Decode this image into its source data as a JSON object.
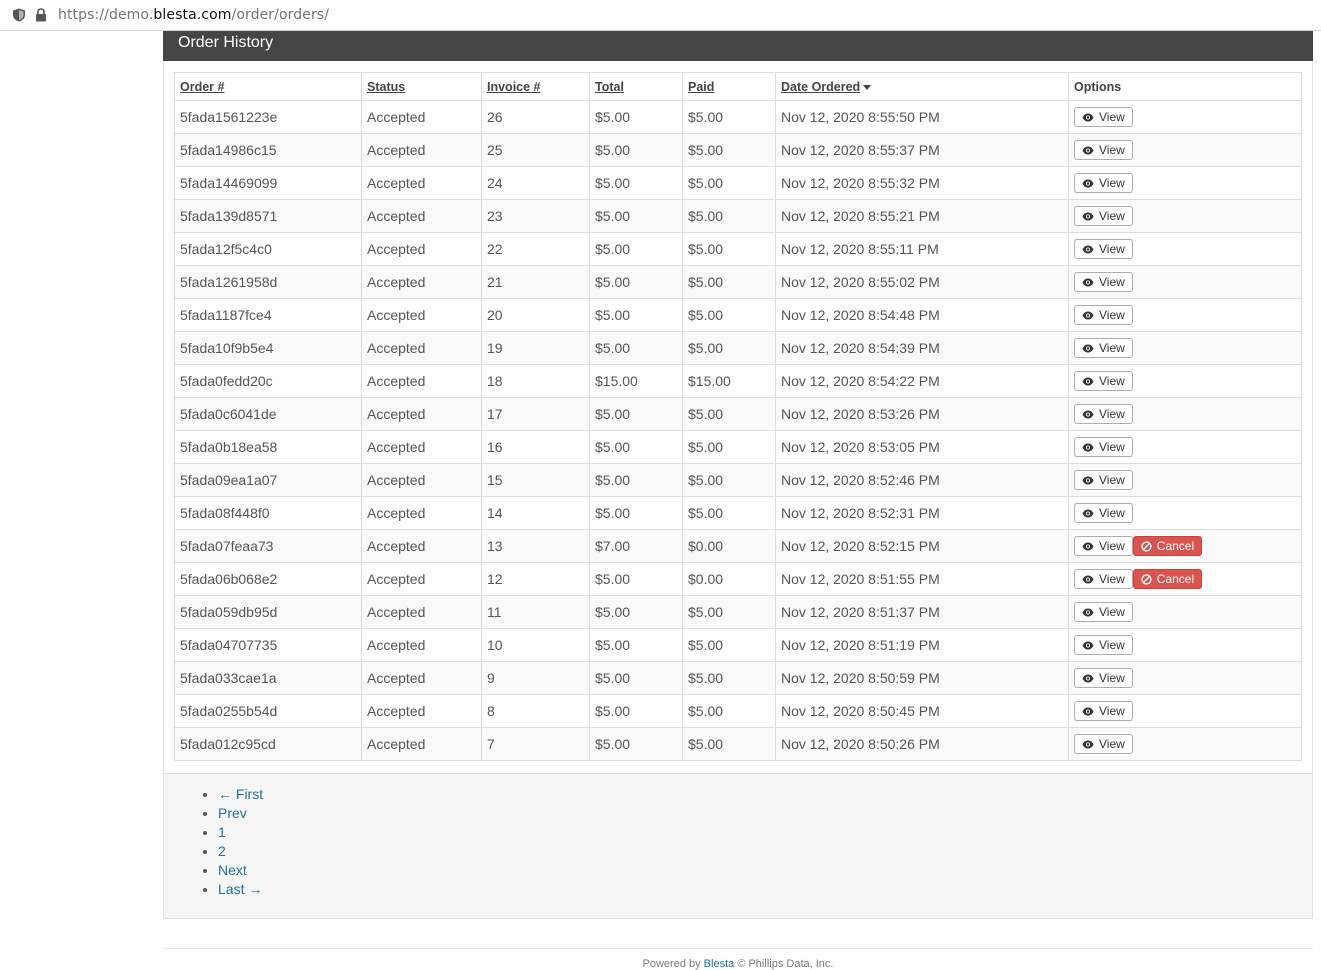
{
  "browser": {
    "url_prefix": "https://demo.",
    "url_domain": "blesta.com",
    "url_path": "/order/orders/"
  },
  "panel": {
    "title": "Order History"
  },
  "table": {
    "headers": {
      "order": "Order #",
      "status": "Status",
      "invoice": "Invoice #",
      "total": "Total",
      "paid": "Paid",
      "date": "Date Ordered",
      "options": "Options"
    },
    "view_label": "View",
    "cancel_label": "Cancel",
    "rows": [
      {
        "order": "5fada1561223e",
        "status": "Accepted",
        "invoice": "26",
        "total": "$5.00",
        "paid": "$5.00",
        "date": "Nov 12, 2020 8:55:50 PM",
        "cancel": false
      },
      {
        "order": "5fada14986c15",
        "status": "Accepted",
        "invoice": "25",
        "total": "$5.00",
        "paid": "$5.00",
        "date": "Nov 12, 2020 8:55:37 PM",
        "cancel": false
      },
      {
        "order": "5fada14469099",
        "status": "Accepted",
        "invoice": "24",
        "total": "$5.00",
        "paid": "$5.00",
        "date": "Nov 12, 2020 8:55:32 PM",
        "cancel": false
      },
      {
        "order": "5fada139d8571",
        "status": "Accepted",
        "invoice": "23",
        "total": "$5.00",
        "paid": "$5.00",
        "date": "Nov 12, 2020 8:55:21 PM",
        "cancel": false
      },
      {
        "order": "5fada12f5c4c0",
        "status": "Accepted",
        "invoice": "22",
        "total": "$5.00",
        "paid": "$5.00",
        "date": "Nov 12, 2020 8:55:11 PM",
        "cancel": false
      },
      {
        "order": "5fada1261958d",
        "status": "Accepted",
        "invoice": "21",
        "total": "$5.00",
        "paid": "$5.00",
        "date": "Nov 12, 2020 8:55:02 PM",
        "cancel": false
      },
      {
        "order": "5fada1187fce4",
        "status": "Accepted",
        "invoice": "20",
        "total": "$5.00",
        "paid": "$5.00",
        "date": "Nov 12, 2020 8:54:48 PM",
        "cancel": false
      },
      {
        "order": "5fada10f9b5e4",
        "status": "Accepted",
        "invoice": "19",
        "total": "$5.00",
        "paid": "$5.00",
        "date": "Nov 12, 2020 8:54:39 PM",
        "cancel": false
      },
      {
        "order": "5fada0fedd20c",
        "status": "Accepted",
        "invoice": "18",
        "total": "$15.00",
        "paid": "$15.00",
        "date": "Nov 12, 2020 8:54:22 PM",
        "cancel": false
      },
      {
        "order": "5fada0c6041de",
        "status": "Accepted",
        "invoice": "17",
        "total": "$5.00",
        "paid": "$5.00",
        "date": "Nov 12, 2020 8:53:26 PM",
        "cancel": false
      },
      {
        "order": "5fada0b18ea58",
        "status": "Accepted",
        "invoice": "16",
        "total": "$5.00",
        "paid": "$5.00",
        "date": "Nov 12, 2020 8:53:05 PM",
        "cancel": false
      },
      {
        "order": "5fada09ea1a07",
        "status": "Accepted",
        "invoice": "15",
        "total": "$5.00",
        "paid": "$5.00",
        "date": "Nov 12, 2020 8:52:46 PM",
        "cancel": false
      },
      {
        "order": "5fada08f448f0",
        "status": "Accepted",
        "invoice": "14",
        "total": "$5.00",
        "paid": "$5.00",
        "date": "Nov 12, 2020 8:52:31 PM",
        "cancel": false
      },
      {
        "order": "5fada07feaa73",
        "status": "Accepted",
        "invoice": "13",
        "total": "$7.00",
        "paid": "$0.00",
        "date": "Nov 12, 2020 8:52:15 PM",
        "cancel": true
      },
      {
        "order": "5fada06b068e2",
        "status": "Accepted",
        "invoice": "12",
        "total": "$5.00",
        "paid": "$0.00",
        "date": "Nov 12, 2020 8:51:55 PM",
        "cancel": true
      },
      {
        "order": "5fada059db95d",
        "status": "Accepted",
        "invoice": "11",
        "total": "$5.00",
        "paid": "$5.00",
        "date": "Nov 12, 2020 8:51:37 PM",
        "cancel": false
      },
      {
        "order": "5fada04707735",
        "status": "Accepted",
        "invoice": "10",
        "total": "$5.00",
        "paid": "$5.00",
        "date": "Nov 12, 2020 8:51:19 PM",
        "cancel": false
      },
      {
        "order": "5fada033cae1a",
        "status": "Accepted",
        "invoice": "9",
        "total": "$5.00",
        "paid": "$5.00",
        "date": "Nov 12, 2020 8:50:59 PM",
        "cancel": false
      },
      {
        "order": "5fada0255b54d",
        "status": "Accepted",
        "invoice": "8",
        "total": "$5.00",
        "paid": "$5.00",
        "date": "Nov 12, 2020 8:50:45 PM",
        "cancel": false
      },
      {
        "order": "5fada012c95cd",
        "status": "Accepted",
        "invoice": "7",
        "total": "$5.00",
        "paid": "$5.00",
        "date": "Nov 12, 2020 8:50:26 PM",
        "cancel": false
      }
    ]
  },
  "pagination": {
    "first": "← First",
    "prev": "Prev",
    "page1": "1",
    "page2": "2",
    "next": "Next",
    "last": "Last →"
  },
  "footer": {
    "powered_by": "Powered by",
    "brand": "Blesta",
    "copyright": "© Phillips Data, Inc."
  },
  "colors": {
    "heading_bg": "#454545",
    "cancel_bg": "#d9534f",
    "link": "#1f6fa3"
  }
}
